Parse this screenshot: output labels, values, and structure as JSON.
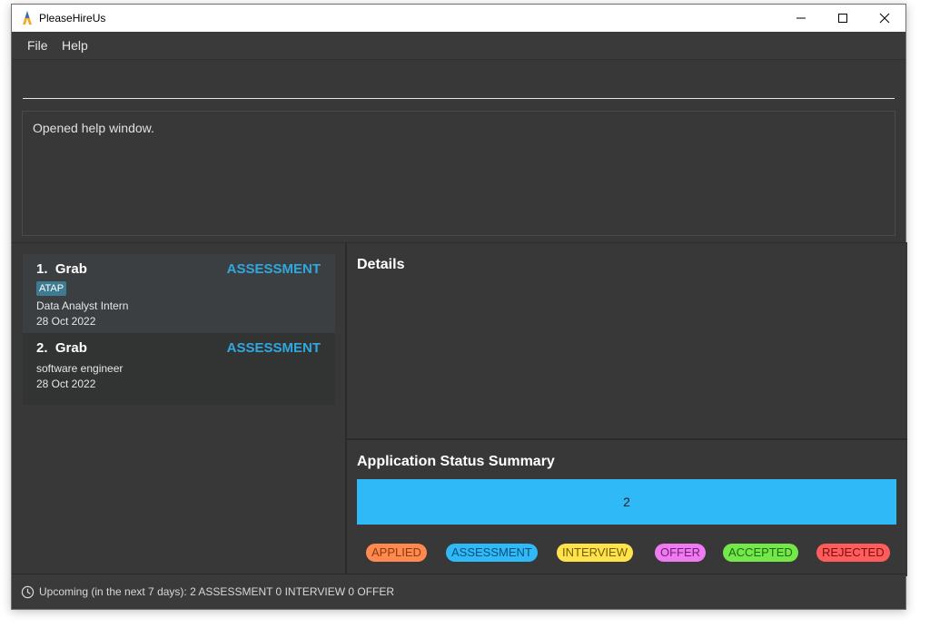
{
  "window": {
    "title": "PleaseHireUs"
  },
  "menu": {
    "file": "File",
    "help": "Help"
  },
  "command": {
    "value": "",
    "placeholder": ""
  },
  "result": {
    "message": "Opened help window."
  },
  "applications": [
    {
      "index": "1.",
      "company": "Grab",
      "status": "ASSESSMENT",
      "tag": "ATAP",
      "role": "Data Analyst Intern",
      "date": "28 Oct 2022"
    },
    {
      "index": "2.",
      "company": "Grab",
      "status": "ASSESSMENT",
      "role": "software engineer",
      "date": "28 Oct 2022"
    }
  ],
  "details": {
    "title": "Details"
  },
  "summary": {
    "title": "Application Status Summary",
    "count": "2",
    "assessment_fraction": 1.0,
    "legend": [
      {
        "label": "APPLIED",
        "bg": "#ff8a50",
        "fg": "#8a3a10"
      },
      {
        "label": "ASSESSMENT",
        "bg": "#2fbaf7",
        "fg": "#0b4e79"
      },
      {
        "label": "INTERVIEW",
        "bg": "#ffe34d",
        "fg": "#7a5a00"
      },
      {
        "label": "OFFER",
        "bg": "#ef7bf1",
        "fg": "#7a1a7c"
      },
      {
        "label": "ACCEPTED",
        "bg": "#74e84a",
        "fg": "#1f6b10"
      },
      {
        "label": "REJECTED",
        "bg": "#ff5c5c",
        "fg": "#7b1010"
      }
    ]
  },
  "status": {
    "text": "Upcoming (in the next 7 days):  2 ASSESSMENT 0 INTERVIEW 0 OFFER"
  }
}
